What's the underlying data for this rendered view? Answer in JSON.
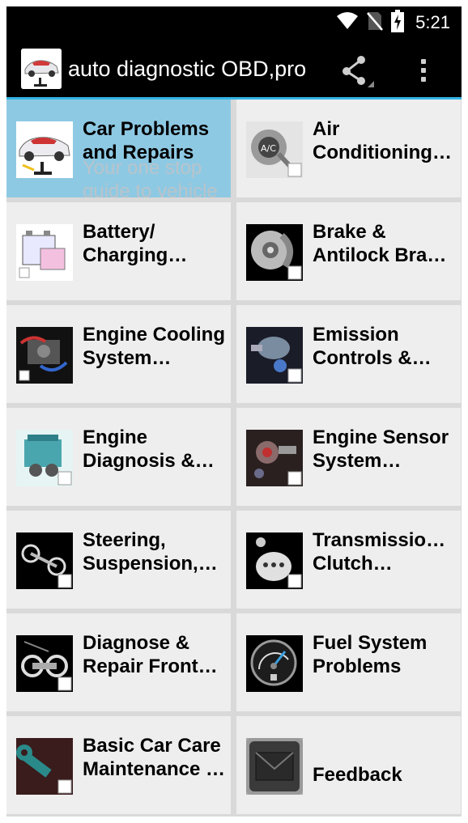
{
  "status_bar": {
    "time": "5:21",
    "icons": [
      "wifi-icon",
      "no-sim-icon",
      "battery-charging-icon"
    ]
  },
  "app_bar": {
    "title": "auto diagnostic OBD,pro",
    "actions": [
      "share-icon",
      "overflow-menu-icon"
    ],
    "accent_color": "#33b5e5"
  },
  "tiles": [
    {
      "line1": "Car Problems",
      "line2": "and Repairs",
      "sub1": "Your one stop",
      "sub2": "guide to vehicle",
      "selected": true,
      "icon": "car-icon"
    },
    {
      "line1": "Air",
      "line2": "Conditioning…",
      "icon": "ac-compressor-icon"
    },
    {
      "line1": "Battery/",
      "line2": "Charging…",
      "icon": "battery-icon"
    },
    {
      "line1": "Brake &",
      "line2": "Antilock Brak…",
      "icon": "brake-disc-icon"
    },
    {
      "line1": "Engine Cooling",
      "line2": "System…",
      "icon": "cooling-system-icon"
    },
    {
      "line1": "Emission",
      "line2": "Controls &…",
      "icon": "emission-filter-icon"
    },
    {
      "line1": "Engine",
      "line2": "Diagnosis &…",
      "icon": "engine-icon"
    },
    {
      "line1": "Engine Sensor",
      "line2": "System…",
      "icon": "engine-sensor-icon"
    },
    {
      "line1": "Steering,",
      "line2": "Suspension,…",
      "icon": "suspension-icon"
    },
    {
      "line1": "Transmission &",
      "line2": "Clutch…",
      "icon": "gear-shift-icon"
    },
    {
      "line1": "Diagnose &",
      "line2": "Repair Front…",
      "icon": "front-axle-icon"
    },
    {
      "line1": "Fuel System",
      "line2": "Problems",
      "icon": "fuel-gauge-icon"
    },
    {
      "line1": "Basic Car Care",
      "line2": "Maintenance …",
      "icon": "wrench-icon"
    },
    {
      "line1": "Feedback",
      "icon": "envelope-icon"
    }
  ],
  "colors": {
    "selected_tile": "#8ec9e3",
    "tile": "#eeeeee",
    "divider": "#d9d9d9"
  }
}
